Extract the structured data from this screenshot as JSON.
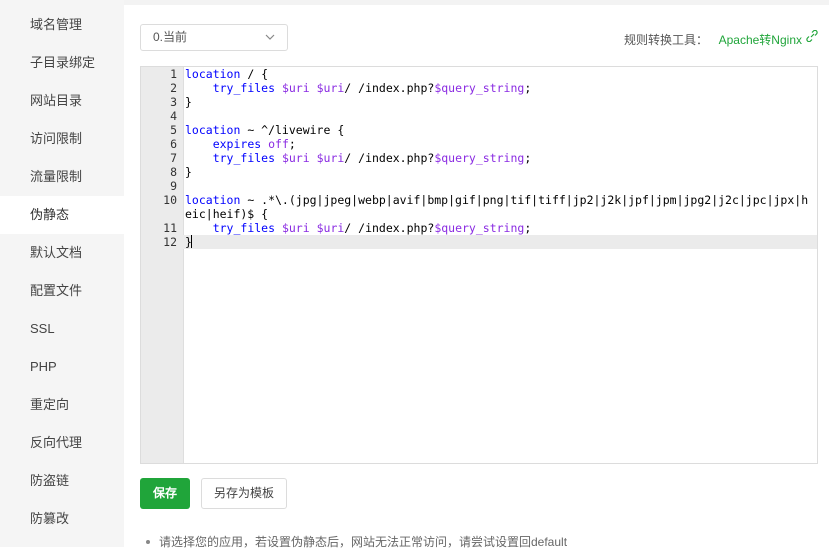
{
  "sidebar": {
    "items": [
      {
        "label": "域名管理"
      },
      {
        "label": "子目录绑定"
      },
      {
        "label": "网站目录"
      },
      {
        "label": "访问限制"
      },
      {
        "label": "流量限制"
      },
      {
        "label": "伪静态",
        "active": true
      },
      {
        "label": "默认文档"
      },
      {
        "label": "配置文件"
      },
      {
        "label": "SSL"
      },
      {
        "label": "PHP"
      },
      {
        "label": "重定向"
      },
      {
        "label": "反向代理"
      },
      {
        "label": "防盗链"
      },
      {
        "label": "防篡改"
      }
    ]
  },
  "toolbar": {
    "template_select_value": "0.当前",
    "converter_label": "规则转换工具：",
    "converter_link": "Apache转Nginx"
  },
  "editor": {
    "current_line": 12,
    "lines": [
      {
        "n": "1",
        "text": "location / {"
      },
      {
        "n": "2",
        "text": "    try_files $uri $uri/ /index.php?$query_string;"
      },
      {
        "n": "3",
        "text": "}"
      },
      {
        "n": "4",
        "text": ""
      },
      {
        "n": "5",
        "text": "location ~ ^/livewire {"
      },
      {
        "n": "6",
        "text": "    expires off;"
      },
      {
        "n": "7",
        "text": "    try_files $uri $uri/ /index.php?$query_string;"
      },
      {
        "n": "8",
        "text": "}"
      },
      {
        "n": "9",
        "text": ""
      },
      {
        "n": "10",
        "text": "location ~ .*\\.(jpg|jpeg|webp|avif|bmp|gif|png|tif|tiff|jp2|j2k|jpf|jpm|jpg2|j2c|jpc|jpx|heic|heif)$ {"
      },
      {
        "n": "11",
        "text": "    try_files $uri $uri/ /index.php?$query_string;"
      },
      {
        "n": "12",
        "text": "}"
      }
    ]
  },
  "actions": {
    "save_label": "保存",
    "save_as_template_label": "另存为模板"
  },
  "note": {
    "text": "请选择您的应用，若设置伪静态后，网站无法正常访问，请尝试设置回default"
  },
  "colors": {
    "accent": "#20a53a",
    "sidebar_bg": "#f5f5f5",
    "gutter_bg": "#ebebeb"
  }
}
